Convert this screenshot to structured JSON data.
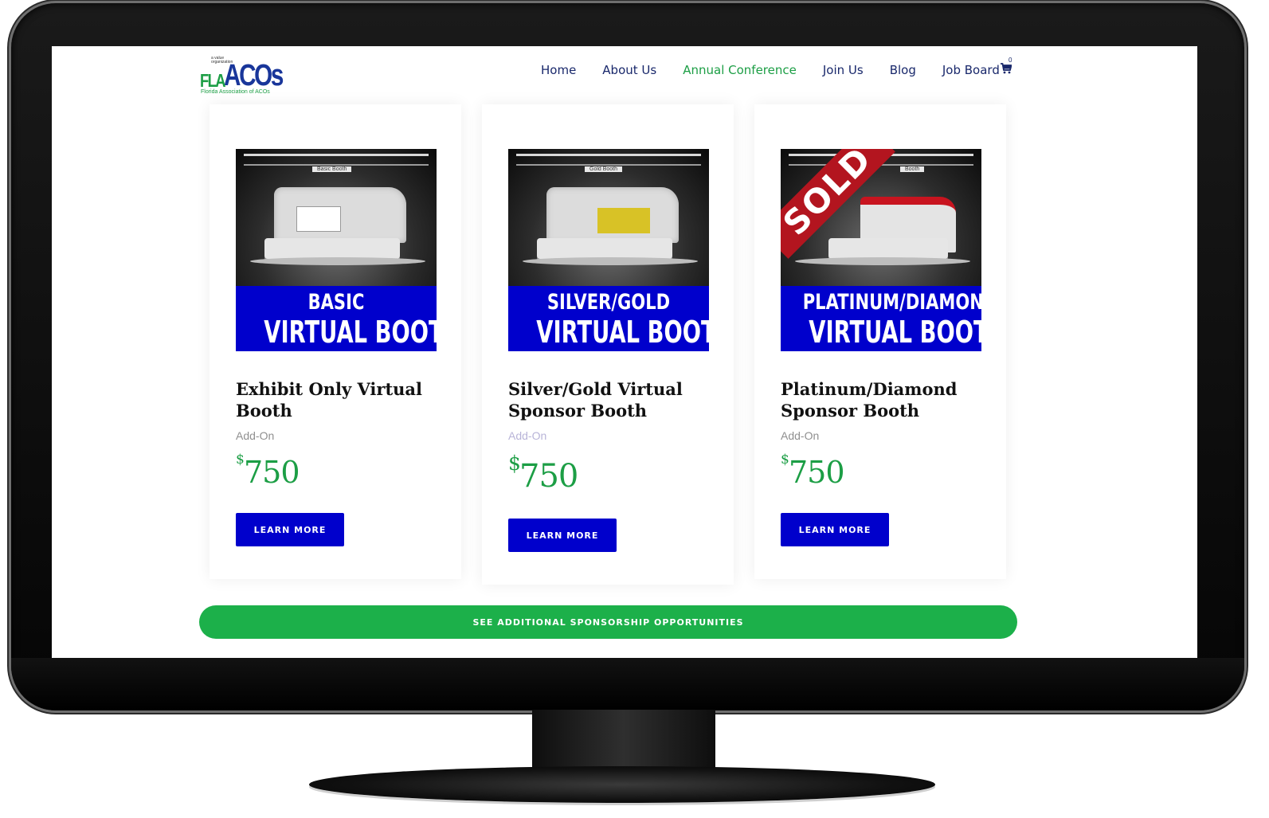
{
  "logo": {
    "tag": "a value organization",
    "fla": "FLA",
    "acos": "ACOs",
    "subtitle": "Florida Association of ACOs"
  },
  "nav": {
    "items": [
      {
        "label": "Home",
        "active": false
      },
      {
        "label": "About Us",
        "active": false
      },
      {
        "label": "Annual Conference",
        "active": true
      },
      {
        "label": "Join Us",
        "active": false
      },
      {
        "label": "Blog",
        "active": false
      },
      {
        "label": "Job Board",
        "active": false
      }
    ],
    "cart_count": "0",
    "cart_icon": "shopping-cart-icon"
  },
  "products": [
    {
      "image": {
        "booth_label": "Basic Booth",
        "line1": "BASIC",
        "line2": "VIRTUAL BOOTH"
      },
      "title": "Exhibit Only Virtual Booth",
      "category": "Add-On",
      "currency": "$",
      "price": "750",
      "button": "Learn more"
    },
    {
      "image": {
        "booth_label": "Gold Booth",
        "line1": "SILVER/GOLD",
        "line2": "VIRTUAL BOOTH"
      },
      "title": "Silver/Gold Virtual Sponsor Booth",
      "category": "Add-On",
      "currency": "$",
      "price": "750",
      "button": "Learn more"
    },
    {
      "image": {
        "booth_label": "Booth",
        "sold": "SOLD",
        "line1": "PLATINUM/DIAMOND",
        "line2": "VIRTUAL BOOTH"
      },
      "title": "Platinum/Diamond Sponsor Booth",
      "category": "Add-On",
      "currency": "$",
      "price": "750",
      "button": "Learn more"
    }
  ],
  "cta": {
    "label": "See additional sponsorship opportunities"
  },
  "colors": {
    "brand_blue": "#0000cc",
    "brand_green": "#1cb04a",
    "nav_text": "#19286b",
    "price_green": "#1c9e45"
  }
}
